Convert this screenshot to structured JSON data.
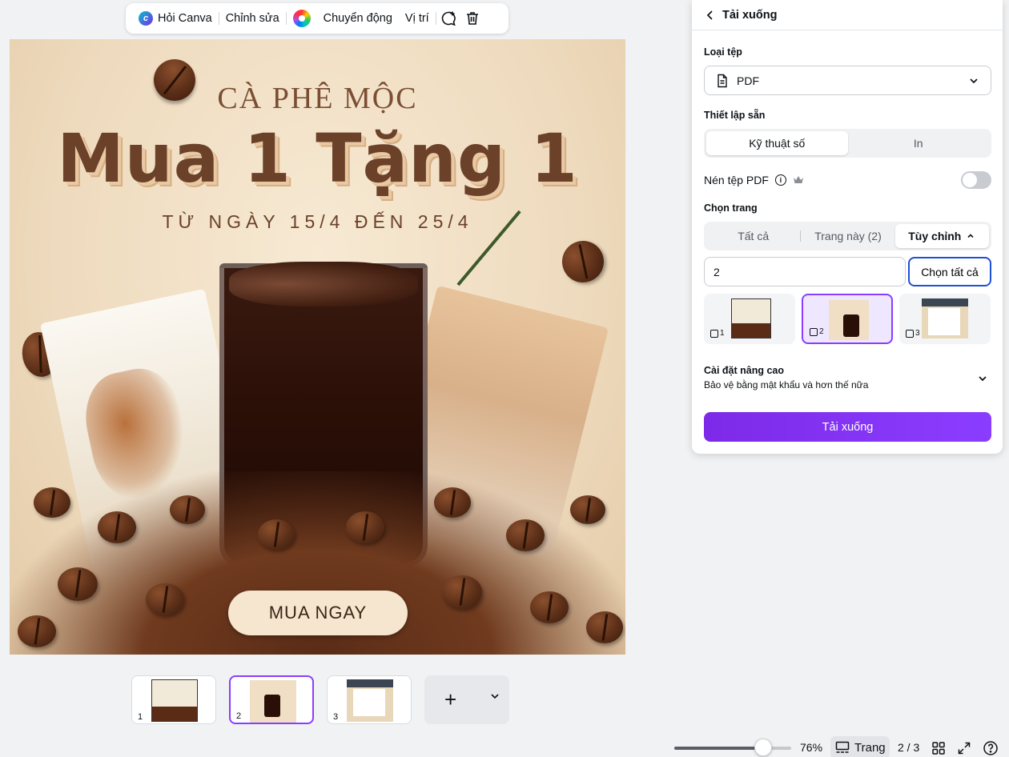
{
  "toolbar": {
    "ask_canva": "Hỏi Canva",
    "edit": "Chỉnh sửa",
    "animate": "Chuyển động",
    "position": "Vị trí"
  },
  "design": {
    "subtitle": "CÀ PHÊ MỘC",
    "headline": "Mua 1 Tặng 1",
    "dates": "TỪ NGÀY 15/4 ĐẾN 25/4",
    "cta": "MUA NGAY",
    "colors": {
      "brown": "#6b4129",
      "background": "#efdcc0"
    }
  },
  "pages": [
    {
      "number": "1",
      "selected": false
    },
    {
      "number": "2",
      "selected": true
    },
    {
      "number": "3",
      "selected": false
    }
  ],
  "status_bar": {
    "zoom": "76%",
    "zoom_fraction": 0.76,
    "pages_label": "Trang",
    "page_counter": "2 / 3"
  },
  "download_panel": {
    "title": "Tải xuống",
    "file_type_label": "Loại tệp",
    "file_type_value": "PDF",
    "preset_label": "Thiết lập sẵn",
    "preset_options": [
      "Kỹ thuật số",
      "In"
    ],
    "preset_selected": "Kỹ thuật số",
    "compress_label": "Nén tệp PDF",
    "compress_enabled": false,
    "pages_label": "Chọn trang",
    "page_options": [
      "Tất cả",
      "Trang này (2)",
      "Tùy chỉnh"
    ],
    "page_option_selected": "Tùy chỉnh",
    "page_range_value": "2",
    "select_all_label": "Chọn tất cả",
    "page_thumbs": [
      {
        "number": "1",
        "selected": false
      },
      {
        "number": "2",
        "selected": true
      },
      {
        "number": "3",
        "selected": false
      }
    ],
    "advanced_title": "Cài đặt nâng cao",
    "advanced_subtitle": "Bảo vệ bằng mật khẩu và hơn thế nữa",
    "download_button": "Tải xuống",
    "accent": "#8b3dff"
  }
}
